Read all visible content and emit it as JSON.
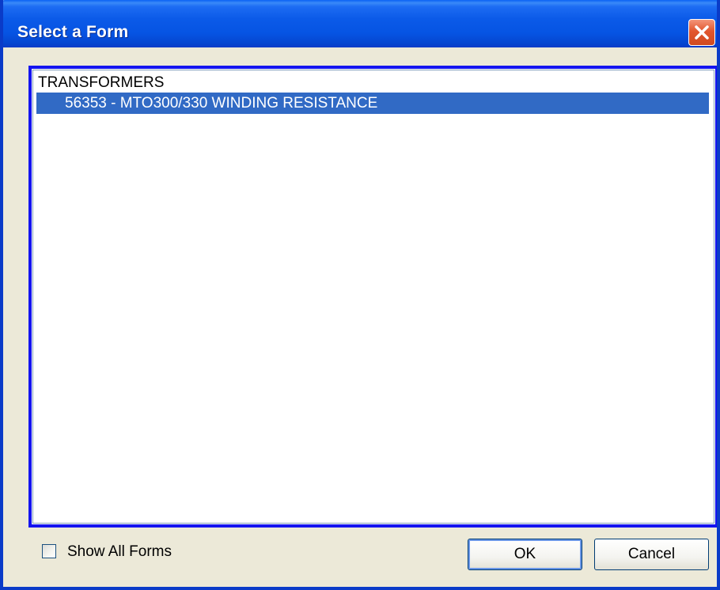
{
  "window": {
    "title": "Select a Form"
  },
  "title_bar": {
    "close_icon": "close-icon"
  },
  "list": {
    "category": "TRANSFORMERS",
    "items": [
      {
        "label": "56353 - MTO300/330 WINDING RESISTANCE",
        "selected": true
      }
    ]
  },
  "options": {
    "show_all_forms_label": "Show All Forms",
    "show_all_forms_checked": false
  },
  "buttons": {
    "ok_label": "OK",
    "cancel_label": "Cancel"
  },
  "colors": {
    "titlebar": "#0A5AE8",
    "selection": "#316AC5",
    "list_focus_border": "#1414F0",
    "dialog_face": "#ECE9D8",
    "close_button": "#E2562E"
  }
}
